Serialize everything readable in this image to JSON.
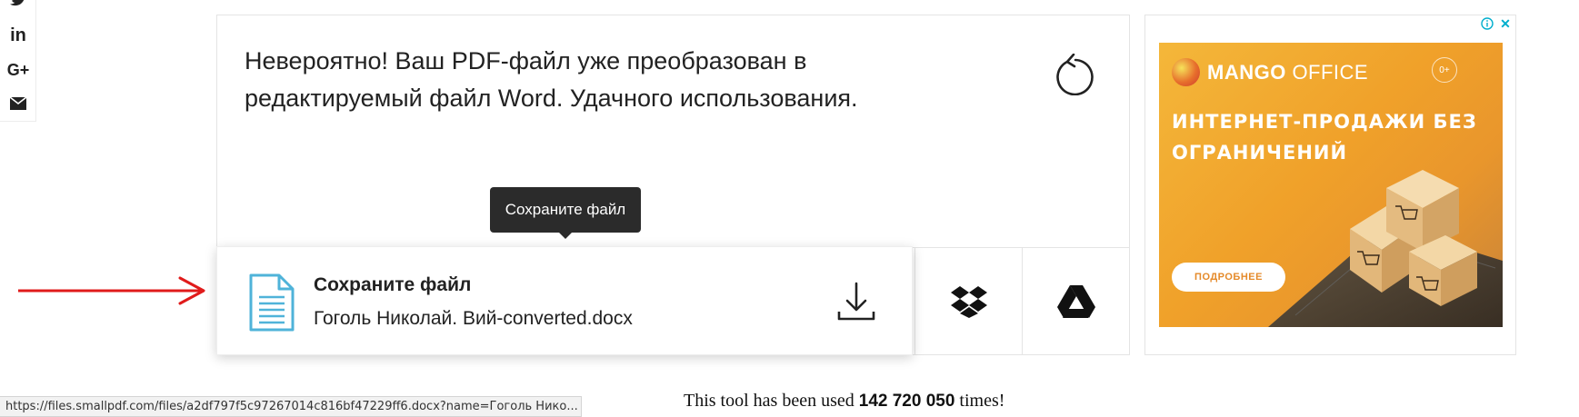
{
  "social": {
    "items": [
      {
        "icon": "twitter-icon"
      },
      {
        "icon": "linkedin-icon",
        "label": "in"
      },
      {
        "icon": "google-plus-icon",
        "label": "G+"
      },
      {
        "icon": "mail-icon"
      }
    ]
  },
  "result": {
    "message": "Невероятно! Ваш PDF-файл уже преобразован в редактируемый файл Word. Удачного использования.",
    "reload_icon": "reload-icon"
  },
  "save": {
    "title": "Сохраните файл",
    "filename": "Гоголь Николай. Вий-converted.docx",
    "tooltip": "Сохраните файл",
    "file_icon": "document-icon",
    "download_icon": "download-icon"
  },
  "cloud": {
    "dropbox_icon": "dropbox-icon",
    "gdrive_icon": "google-drive-icon"
  },
  "ad": {
    "brand_bold": "MANGO",
    "brand_light": " OFFICE",
    "headline": "ИНТЕРНЕТ-ПРОДАЖИ БЕЗ ОГРАНИЧЕНИЙ",
    "cta": "ПОДРОБНЕЕ",
    "age": "0+",
    "close": "✕",
    "accent": "#f0a12a"
  },
  "status_url": "https://files.smallpdf.com/files/a2df797f5c97267014c816bf47229ff6.docx?name=Гоголь Нико...",
  "usage": {
    "prefix": "This tool has been used ",
    "count": "142 720 050",
    "suffix": " times!"
  },
  "colors": {
    "annotation_arrow": "#e01b1b",
    "file_icon": "#4fb3d9",
    "tooltip_bg": "#2b2b2b"
  }
}
